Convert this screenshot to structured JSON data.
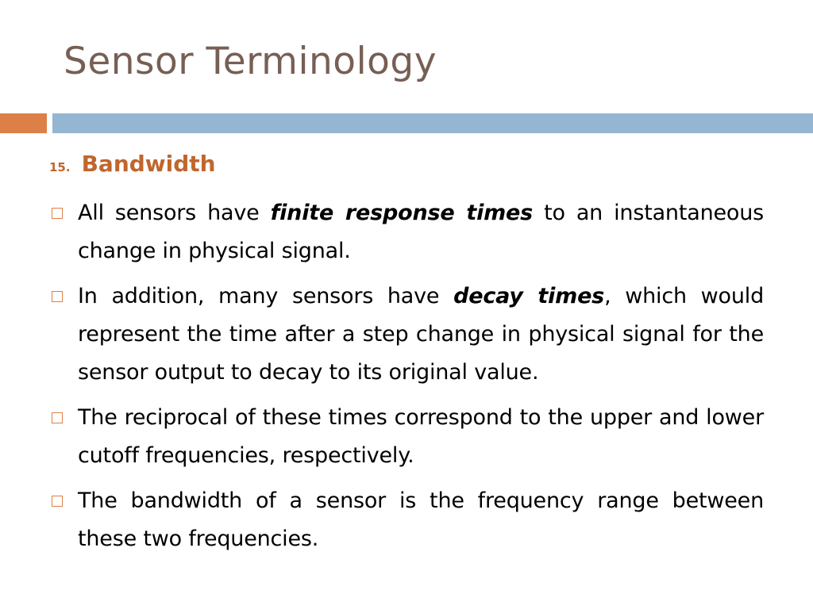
{
  "slide": {
    "title": "Sensor Terminology",
    "accent_colors": {
      "title": "#775F55",
      "heading": "#C0662D",
      "bar_left": "#DD8047",
      "bar_right": "#94B6D2",
      "bullet_marker": "#DD8047"
    },
    "section": {
      "number": "15.",
      "title": "Bandwidth"
    },
    "bullet_icon": "hollow-square-bullet-icon",
    "bullets": [
      {
        "segments": [
          {
            "text": "All sensors have ",
            "emphasis": false
          },
          {
            "text": "finite response times",
            "emphasis": true
          },
          {
            "text": " to an instantaneous change in physical signal.",
            "emphasis": false
          }
        ]
      },
      {
        "segments": [
          {
            "text": "In addition, many sensors have ",
            "emphasis": false
          },
          {
            "text": "decay times",
            "emphasis": true
          },
          {
            "text": ", which would represent the time after a step change in physical signal for the sensor output to decay to its original value.",
            "emphasis": false
          }
        ]
      },
      {
        "segments": [
          {
            "text": "The reciprocal of these times correspond to the upper and lower cutoff frequencies, respectively.",
            "emphasis": false
          }
        ]
      },
      {
        "segments": [
          {
            "text": "The bandwidth of a sensor is the frequency range between these two frequencies.",
            "emphasis": false
          }
        ]
      }
    ]
  }
}
